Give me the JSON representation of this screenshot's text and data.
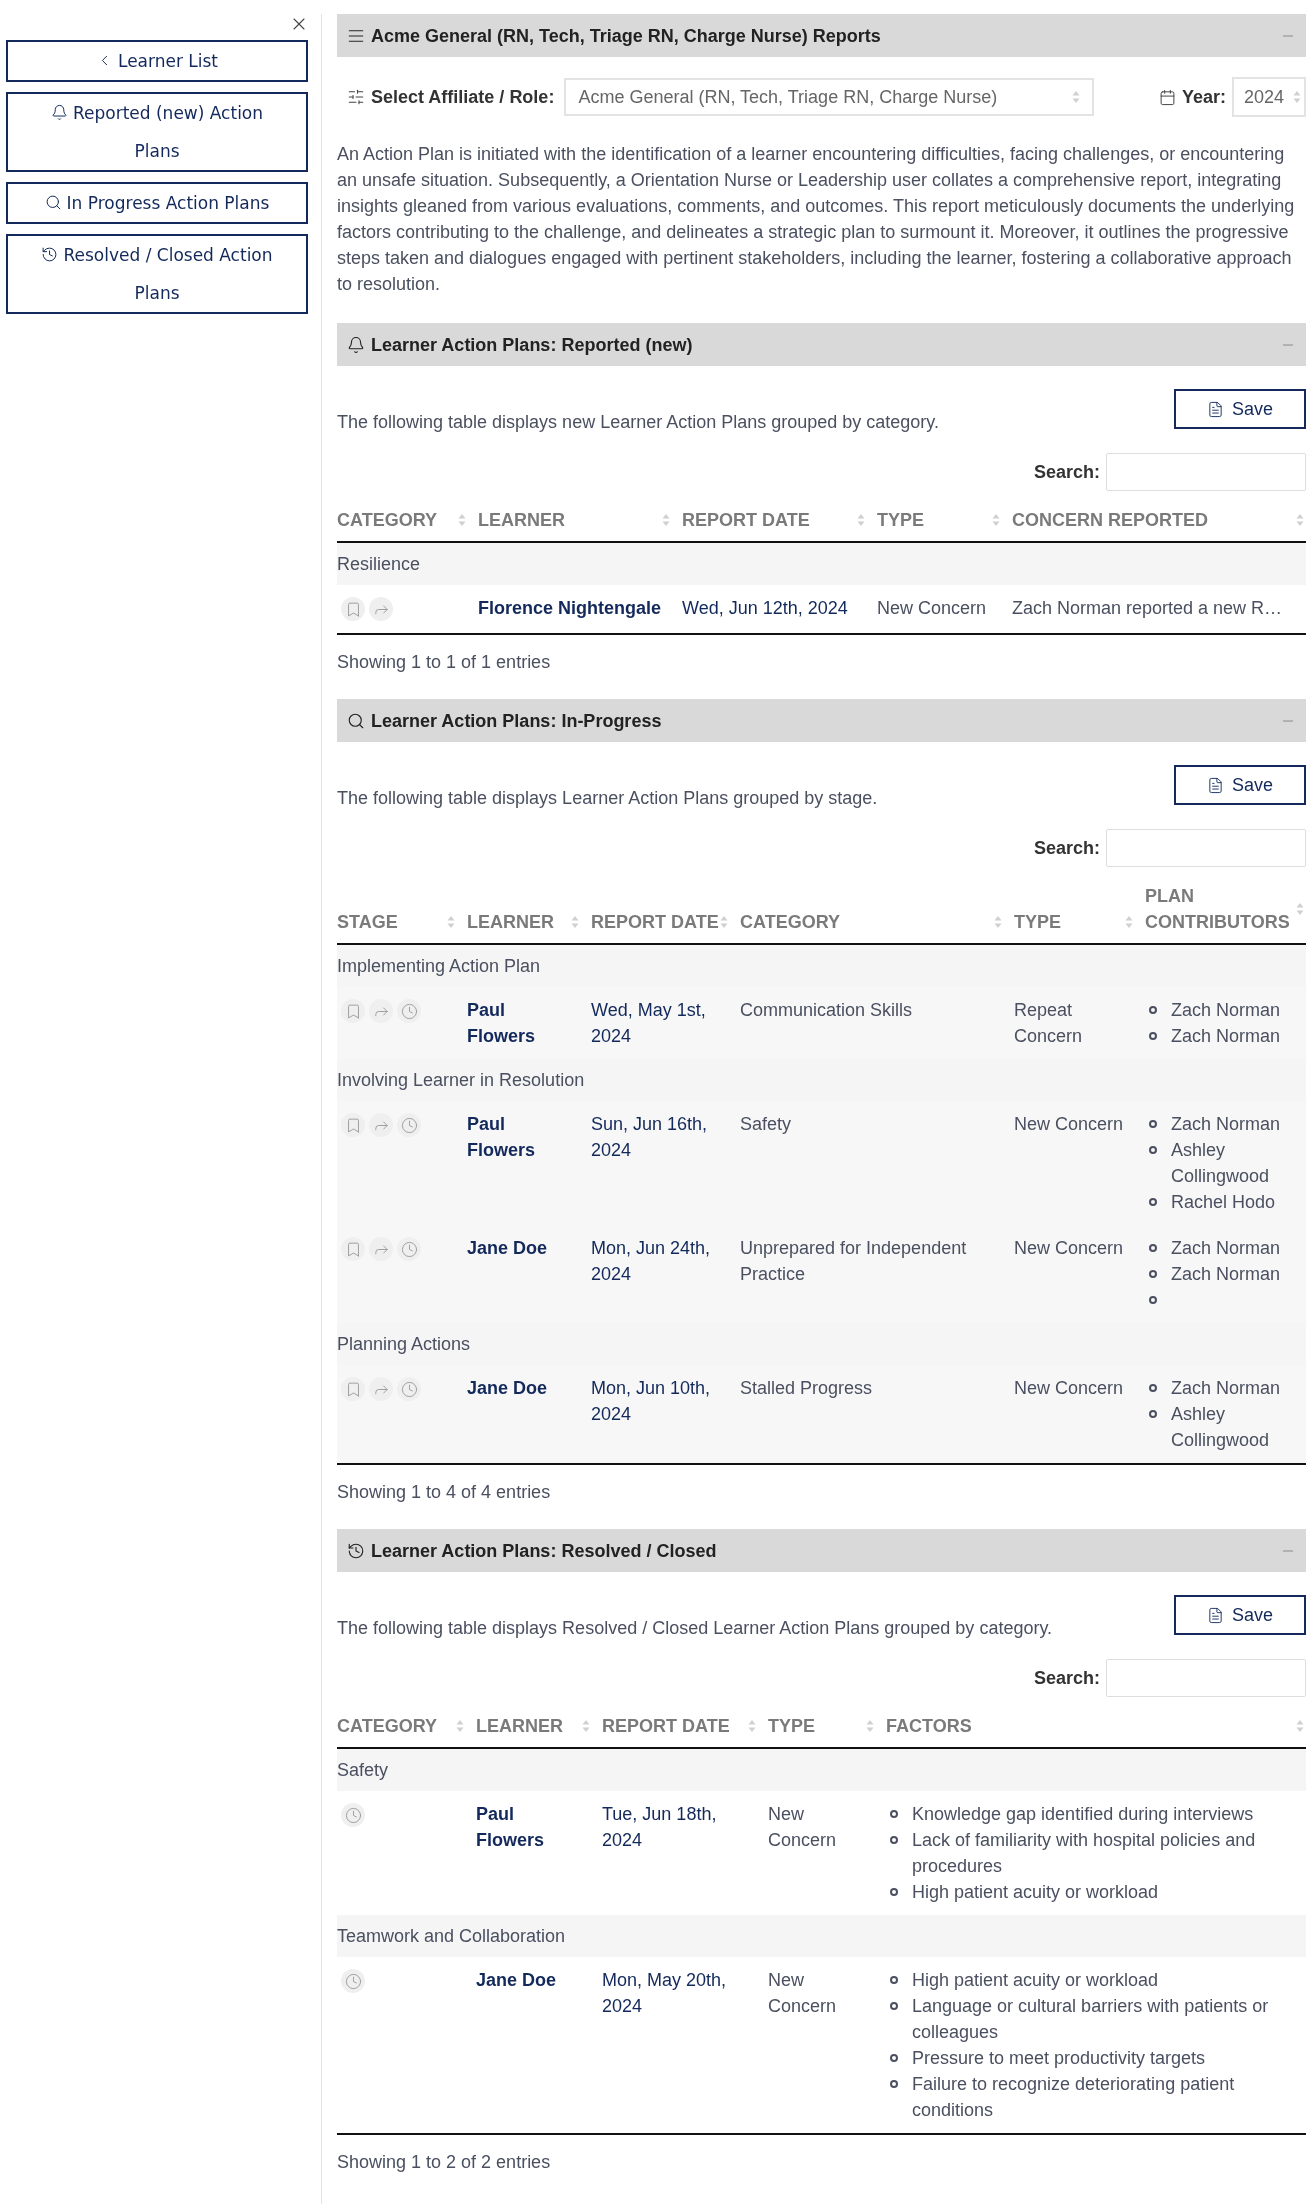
{
  "sidebar": {
    "buttons": [
      {
        "label": "Learner List"
      },
      {
        "label": "Reported (new) Action Plans"
      },
      {
        "label": "In Progress Action Plans"
      },
      {
        "label": "Resolved / Closed Action Plans"
      }
    ]
  },
  "report": {
    "title": "Acme General (RN, Tech, Triage RN, Charge Nurse) Reports",
    "affiliate_label": "Select Affiliate / Role:",
    "affiliate_value": "Acme General (RN, Tech, Triage RN, Charge Nurse)",
    "year_label": "Year:",
    "year_value": "2024",
    "intro": "An Action Plan is initiated with the identification of a learner encountering difficulties, facing challenges, or encountering an unsafe situation. Subsequently, a Orientation Nurse or Leadership user collates a comprehensive report, integrating insights gleaned from various evaluations, comments, and outcomes. This report meticulously documents the underlying factors contributing to the challenge, and delineates a strategic plan to surmount it. Moreover, it outlines the progressive steps taken and dialogues engaged with pertinent stakeholders, including the learner, fostering a collaborative approach to resolution."
  },
  "sections": [
    {
      "kind": "reported",
      "title": "Learner Action Plans: Reported (new)",
      "description": "The following table displays new Learner Action Plans grouped by category.",
      "save": "Save",
      "search_label": "Search:",
      "columns": [
        "CATEGORY",
        "LEARNER",
        "REPORT DATE",
        "TYPE",
        "CONCERN REPORTED"
      ],
      "groups": [
        {
          "label": "Resilience",
          "rows": [
            {
              "cells": [
                "Florence Nightengale",
                "Wed, Jun 12th, 2024",
                "New Concern",
                "Zach Norman reported a new R…"
              ]
            }
          ]
        }
      ],
      "footer": "Showing 1 to 1 of 1 entries"
    },
    {
      "kind": "in_progress",
      "title": "Learner Action Plans: In-Progress",
      "description": "The following table displays Learner Action Plans grouped by stage.",
      "save": "Save",
      "search_label": "Search:",
      "columns": [
        "STAGE",
        "LEARNER",
        "REPORT DATE",
        "CATEGORY",
        "TYPE",
        "PLAN CONTRIBUTORS"
      ],
      "groups": [
        {
          "label": "Implementing Action Plan",
          "rows": [
            {
              "cells": [
                "Paul Flowers",
                "Wed, May 1st, 2024",
                "Communication Skills",
                "Repeat Concern",
                [
                  "Zach Norman",
                  "Zach Norman"
                ]
              ]
            }
          ]
        },
        {
          "label": "Involving Learner in Resolution",
          "rows": [
            {
              "cells": [
                "Paul Flowers",
                "Sun, Jun 16th, 2024",
                "Safety",
                "New Concern",
                [
                  "Zach Norman",
                  "Ashley Collingwood",
                  "Rachel Hodo"
                ]
              ]
            },
            {
              "cells": [
                "Jane Doe",
                "Mon, Jun 24th, 2024",
                "Unprepared for Independent Practice",
                "New Concern",
                [
                  "Zach Norman",
                  "Zach Norman",
                  null
                ]
              ]
            }
          ]
        },
        {
          "label": "Planning Actions",
          "rows": [
            {
              "cells": [
                "Jane Doe",
                "Mon, Jun 10th, 2024",
                "Stalled Progress",
                "New Concern",
                [
                  "Zach Norman",
                  "Ashley Collingwood"
                ]
              ]
            }
          ]
        }
      ],
      "footer": "Showing 1 to 4 of 4 entries"
    },
    {
      "kind": "resolved",
      "title": "Learner Action Plans: Resolved / Closed",
      "description": "The following table displays Resolved / Closed Learner Action Plans grouped by category.",
      "save": "Save",
      "search_label": "Search:",
      "columns": [
        "CATEGORY",
        "LEARNER",
        "REPORT DATE",
        "TYPE",
        "FACTORS"
      ],
      "groups": [
        {
          "label": "Safety",
          "rows": [
            {
              "cells": [
                "Paul Flowers",
                "Tue, Jun 18th, 2024",
                "New Concern",
                [
                  "Knowledge gap identified during interviews",
                  "Lack of familiarity with hospital policies and procedures",
                  "High patient acuity or workload"
                ]
              ]
            }
          ]
        },
        {
          "label": "Teamwork and Collaboration",
          "rows": [
            {
              "cells": [
                "Jane Doe",
                "Mon, May 20th, 2024",
                "New Concern",
                [
                  "High patient acuity or workload",
                  "Language or cultural barriers with patients or colleagues",
                  "Pressure to meet productivity targets",
                  "Failure to recognize deteriorating patient conditions"
                ]
              ]
            }
          ]
        }
      ],
      "footer": "Showing 1 to 2 of 2 entries"
    }
  ]
}
